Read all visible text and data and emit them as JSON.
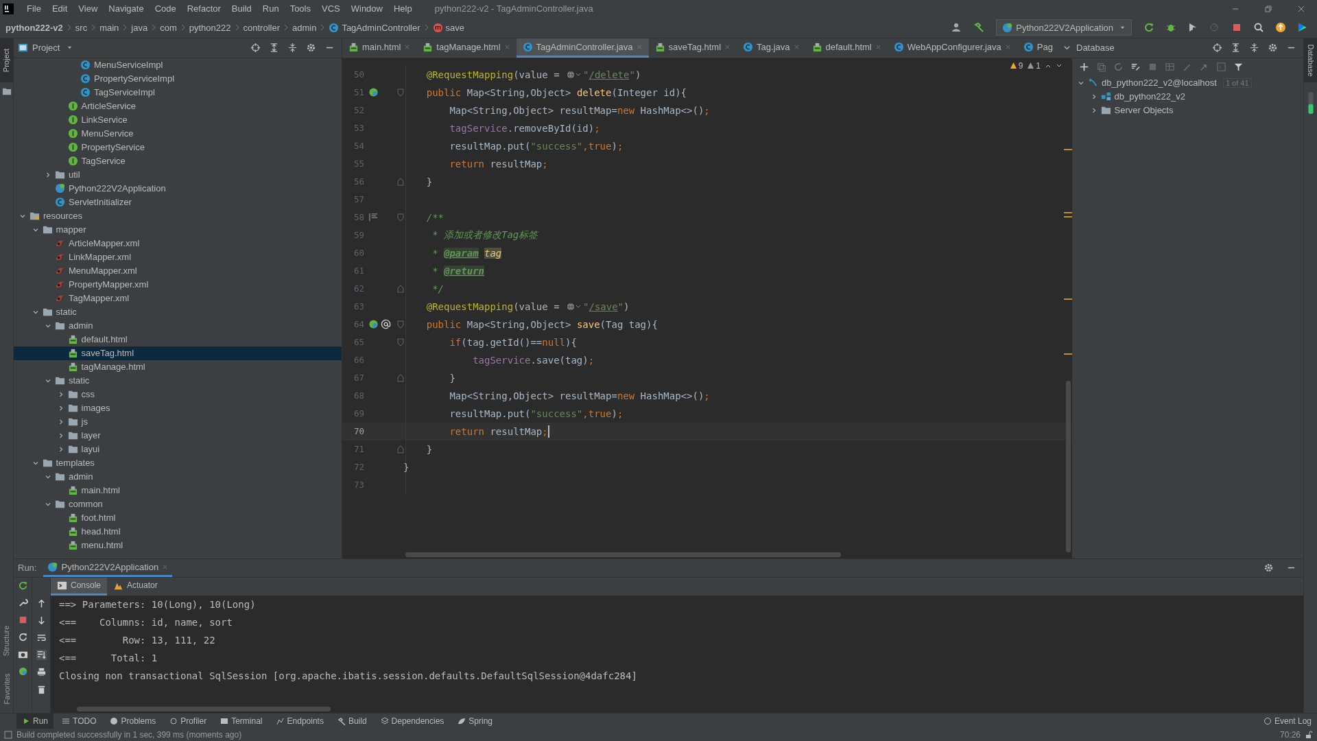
{
  "window": {
    "title": "python222-v2 - TagAdminController.java"
  },
  "menu": [
    "File",
    "Edit",
    "View",
    "Navigate",
    "Code",
    "Refactor",
    "Build",
    "Run",
    "Tools",
    "VCS",
    "Window",
    "Help"
  ],
  "breadcrumb": [
    {
      "label": "python222-v2",
      "kind": "project"
    },
    {
      "label": "src",
      "kind": "dir"
    },
    {
      "label": "main",
      "kind": "dir"
    },
    {
      "label": "java",
      "kind": "dir"
    },
    {
      "label": "com",
      "kind": "dir"
    },
    {
      "label": "python222",
      "kind": "dir"
    },
    {
      "label": "controller",
      "kind": "dir"
    },
    {
      "label": "admin",
      "kind": "dir"
    },
    {
      "label": "TagAdminController",
      "kind": "class"
    },
    {
      "label": "save",
      "kind": "method"
    }
  ],
  "run_config": {
    "label": "Python222V2Application"
  },
  "project_panel": {
    "title": "Project",
    "tree": [
      {
        "children": [
          {
            "children": [
              {
                "children": [
                  {
                    "children": [
                      {
                        "label": "MenuServiceImpl",
                        "kind": "class",
                        "selected": false
                      },
                      {
                        "label": "PropertyServiceImpl",
                        "kind": "class",
                        "selected": false
                      },
                      {
                        "label": "TagServiceImpl",
                        "kind": "class",
                        "selected": false
                      }
                    ]
                  },
                  {
                    "label": "ArticleService",
                    "kind": "interface",
                    "selected": false
                  },
                  {
                    "label": "LinkService",
                    "kind": "interface",
                    "selected": false
                  },
                  {
                    "label": "MenuService",
                    "kind": "interface",
                    "selected": false
                  },
                  {
                    "label": "PropertyService",
                    "kind": "interface",
                    "selected": false
                  },
                  {
                    "label": "TagService",
                    "kind": "interface",
                    "selected": false
                  }
                ]
              },
              {
                "label": "util",
                "kind": "folder",
                "expanded": false,
                "selected": false
              },
              {
                "label": "Python222V2Application",
                "kind": "app",
                "selected": false
              },
              {
                "label": "ServletInitializer",
                "kind": "class",
                "selected": false
              }
            ]
          }
        ]
      },
      {
        "label": "resources",
        "kind": "resources-folder",
        "expanded": true,
        "selected": false,
        "children": [
          {
            "label": "mapper",
            "kind": "folder",
            "expanded": true,
            "selected": false,
            "children": [
              {
                "label": "ArticleMapper.xml",
                "kind": "mybatis",
                "selected": false
              },
              {
                "label": "LinkMapper.xml",
                "kind": "mybatis",
                "selected": false
              },
              {
                "label": "MenuMapper.xml",
                "kind": "mybatis",
                "selected": false
              },
              {
                "label": "PropertyMapper.xml",
                "kind": "mybatis",
                "selected": false
              },
              {
                "label": "TagMapper.xml",
                "kind": "mybatis",
                "selected": false
              }
            ]
          },
          {
            "label": "static",
            "kind": "folder",
            "expanded": true,
            "selected": false,
            "children": [
              {
                "label": "admin",
                "kind": "folder",
                "expanded": true,
                "selected": false,
                "children": [
                  {
                    "label": "default.html",
                    "kind": "html",
                    "selected": false
                  },
                  {
                    "label": "saveTag.html",
                    "kind": "html",
                    "selected": true
                  },
                  {
                    "label": "tagManage.html",
                    "kind": "html",
                    "selected": false
                  }
                ]
              },
              {
                "label": "static",
                "kind": "folder",
                "expanded": true,
                "selected": false,
                "children": [
                  {
                    "label": "css",
                    "kind": "folder",
                    "expanded": false,
                    "selected": false
                  },
                  {
                    "label": "images",
                    "kind": "folder",
                    "expanded": false,
                    "selected": false
                  },
                  {
                    "label": "js",
                    "kind": "folder",
                    "expanded": false,
                    "selected": false
                  },
                  {
                    "label": "layer",
                    "kind": "folder",
                    "expanded": false,
                    "selected": false
                  },
                  {
                    "label": "layui",
                    "kind": "folder",
                    "expanded": false,
                    "selected": false
                  }
                ]
              }
            ]
          },
          {
            "label": "templates",
            "kind": "folder",
            "expanded": true,
            "selected": false,
            "children": [
              {
                "label": "admin",
                "kind": "folder",
                "expanded": true,
                "selected": false,
                "children": [
                  {
                    "label": "main.html",
                    "kind": "html",
                    "selected": false
                  }
                ]
              },
              {
                "label": "common",
                "kind": "folder",
                "expanded": true,
                "selected": false,
                "children": [
                  {
                    "label": "foot.html",
                    "kind": "html",
                    "selected": false
                  },
                  {
                    "label": "head.html",
                    "kind": "html",
                    "selected": false
                  },
                  {
                    "label": "menu.html",
                    "kind": "html",
                    "selected": false
                  }
                ]
              }
            ]
          }
        ]
      }
    ]
  },
  "editor": {
    "tabs": [
      {
        "label": "main.html",
        "kind": "html",
        "selected": false
      },
      {
        "label": "tagManage.html",
        "kind": "html",
        "selected": false
      },
      {
        "label": "TagAdminController.java",
        "kind": "class",
        "selected": true
      },
      {
        "label": "saveTag.html",
        "kind": "html",
        "selected": false
      },
      {
        "label": "Tag.java",
        "kind": "class",
        "selected": false
      },
      {
        "label": "default.html",
        "kind": "html",
        "selected": false
      },
      {
        "label": "WebAppConfigurer.java",
        "kind": "class",
        "selected": false
      },
      {
        "label": "Pag",
        "kind": "class",
        "selected": false
      }
    ],
    "problems": {
      "warnings": "9",
      "weak_warnings": "1"
    },
    "lines": [
      {
        "number": "50",
        "current": false,
        "tokens": [
          {
            "kind": "annotation",
            "text": "    @RequestMapping"
          },
          {
            "kind": "plain",
            "text": "(value = "
          },
          {
            "kind": "inlay"
          },
          {
            "kind": "string",
            "text": "\""
          },
          {
            "kind": "url",
            "text": "/delete"
          },
          {
            "kind": "string",
            "text": "\""
          },
          {
            "kind": "plain",
            "text": ")"
          }
        ]
      },
      {
        "number": "51",
        "current": false,
        "gutter": {
          "kind": "spring"
        },
        "fold": {
          "kind": "start"
        },
        "tokens": [
          {
            "kind": "keyword",
            "text": "    public"
          },
          {
            "kind": "plain",
            "text": " Map<String,Object> "
          },
          {
            "kind": "method",
            "text": "delete"
          },
          {
            "kind": "plain",
            "text": "(Integer id){"
          }
        ]
      },
      {
        "number": "52",
        "current": false,
        "tokens": [
          {
            "kind": "plain",
            "text": "        Map<String,Object> resultMap="
          },
          {
            "kind": "keyword",
            "text": "new"
          },
          {
            "kind": "plain",
            "text": " HashMap<>()"
          },
          {
            "kind": "keyword",
            "text": ";"
          }
        ]
      },
      {
        "number": "53",
        "current": false,
        "tokens": [
          {
            "kind": "field",
            "text": "        tagService"
          },
          {
            "kind": "plain",
            "text": ".removeById(id)"
          },
          {
            "kind": "keyword",
            "text": ";"
          }
        ]
      },
      {
        "number": "54",
        "current": false,
        "tokens": [
          {
            "kind": "plain",
            "text": "        resultMap.put("
          },
          {
            "kind": "string",
            "text": "\"success\""
          },
          {
            "kind": "keyword",
            "text": ",true"
          },
          {
            "kind": "plain",
            "text": ")"
          },
          {
            "kind": "keyword",
            "text": ";"
          }
        ]
      },
      {
        "number": "55",
        "current": false,
        "tokens": [
          {
            "kind": "keyword",
            "text": "        return"
          },
          {
            "kind": "plain",
            "text": " resultMap"
          },
          {
            "kind": "keyword",
            "text": ";"
          }
        ]
      },
      {
        "number": "56",
        "current": false,
        "fold": {
          "kind": "end"
        },
        "tokens": [
          {
            "kind": "plain",
            "text": "    }"
          }
        ]
      },
      {
        "number": "57",
        "current": false
      },
      {
        "number": "58",
        "current": false,
        "gutter": {
          "kind": "doc"
        },
        "fold": {
          "kind": "start"
        },
        "tokens": [
          {
            "kind": "comment",
            "text": "    /**"
          }
        ]
      },
      {
        "number": "59",
        "current": false,
        "tokens": [
          {
            "kind": "comment",
            "text": "     * 添加或者修改Tag标签"
          }
        ]
      },
      {
        "number": "60",
        "current": false,
        "tokens": [
          {
            "kind": "comment",
            "text": "     * "
          },
          {
            "kind": "doctag",
            "text": "@param"
          },
          {
            "kind": "docparam",
            "text": "tag"
          }
        ]
      },
      {
        "number": "61",
        "current": false,
        "tokens": [
          {
            "kind": "comment",
            "text": "     * "
          },
          {
            "kind": "doctag",
            "text": "@return"
          }
        ]
      },
      {
        "number": "62",
        "current": false,
        "fold": {
          "kind": "end"
        },
        "tokens": [
          {
            "kind": "comment",
            "text": "     */"
          }
        ]
      },
      {
        "number": "63",
        "current": false,
        "tokens": [
          {
            "kind": "annotation",
            "text": "    @RequestMapping"
          },
          {
            "kind": "plain",
            "text": "(value = "
          },
          {
            "kind": "inlay"
          },
          {
            "kind": "string",
            "text": "\""
          },
          {
            "kind": "url",
            "text": "/save"
          },
          {
            "kind": "string",
            "text": "\""
          },
          {
            "kind": "plain",
            "text": ")"
          }
        ]
      },
      {
        "number": "64",
        "current": false,
        "gutter": {
          "kind": "spring-at"
        },
        "fold": {
          "kind": "start"
        },
        "tokens": [
          {
            "kind": "keyword",
            "text": "    public"
          },
          {
            "kind": "plain",
            "text": " Map<String,Object> "
          },
          {
            "kind": "method",
            "text": "save"
          },
          {
            "kind": "plain",
            "text": "(Tag tag){"
          }
        ]
      },
      {
        "number": "65",
        "current": false,
        "fold": {
          "kind": "start"
        },
        "tokens": [
          {
            "kind": "keyword",
            "text": "        if"
          },
          {
            "kind": "plain",
            "text": "(tag.getId()=="
          },
          {
            "kind": "keyword",
            "text": "null"
          },
          {
            "kind": "plain",
            "text": "){"
          }
        ]
      },
      {
        "number": "66",
        "current": false,
        "tokens": [
          {
            "kind": "field",
            "text": "            tagService"
          },
          {
            "kind": "plain",
            "text": ".save(tag)"
          },
          {
            "kind": "keyword",
            "text": ";"
          }
        ]
      },
      {
        "number": "67",
        "current": false,
        "fold": {
          "kind": "end"
        },
        "tokens": [
          {
            "kind": "plain",
            "text": "        }"
          }
        ]
      },
      {
        "number": "68",
        "current": false,
        "tokens": [
          {
            "kind": "plain",
            "text": "        Map<String,Object> resultMap="
          },
          {
            "kind": "keyword",
            "text": "new"
          },
          {
            "kind": "plain",
            "text": " HashMap<>()"
          },
          {
            "kind": "keyword",
            "text": ";"
          }
        ]
      },
      {
        "number": "69",
        "current": false,
        "tokens": [
          {
            "kind": "plain",
            "text": "        resultMap.put("
          },
          {
            "kind": "string",
            "text": "\"success\""
          },
          {
            "kind": "keyword",
            "text": ",true"
          },
          {
            "kind": "plain",
            "text": ")"
          },
          {
            "kind": "keyword",
            "text": ";"
          }
        ]
      },
      {
        "number": "70",
        "current": true,
        "tokens": [
          {
            "kind": "keyword",
            "text": "        return"
          },
          {
            "kind": "plain",
            "text": " resultMap"
          },
          {
            "kind": "keyword",
            "text": ";"
          }
        ]
      },
      {
        "number": "71",
        "current": false,
        "fold": {
          "kind": "end"
        },
        "tokens": [
          {
            "kind": "plain",
            "text": "    }"
          }
        ]
      },
      {
        "number": "72",
        "current": false,
        "tokens": [
          {
            "kind": "plain",
            "text": "}"
          }
        ]
      },
      {
        "number": "73",
        "current": false
      }
    ]
  },
  "database_panel": {
    "title": "Database",
    "tree": [
      {
        "label": "db_python222_v2@localhost",
        "badge": "1 of 41",
        "kind": "datasource",
        "expanded": true,
        "selected": false,
        "children": [
          {
            "label": "db_python222_v2",
            "kind": "schema",
            "expanded": false,
            "selected": false
          },
          {
            "label": "Server Objects",
            "kind": "folder",
            "expanded": false,
            "selected": false
          }
        ]
      }
    ]
  },
  "run_panel": {
    "label": "Run:",
    "tabs": [
      {
        "label": "Python222V2Application",
        "selected": true
      }
    ],
    "subtabs": [
      {
        "label": "Console",
        "kind": "console",
        "selected": true
      },
      {
        "label": "Actuator",
        "kind": "actuator",
        "selected": false
      }
    ],
    "console": [
      "==> Parameters: 10(Long), 10(Long)",
      "<==    Columns: id, name, sort",
      "<==        Row: 13, 111, 22",
      "<==      Total: 1",
      "Closing non transactional SqlSession [org.apache.ibatis.session.defaults.DefaultSqlSession@4dafc284]"
    ]
  },
  "tool_tabs": [
    {
      "label": "Run",
      "kind": "run",
      "selected": true
    },
    {
      "label": "TODO",
      "kind": "todo",
      "selected": false
    },
    {
      "label": "Problems",
      "kind": "problems",
      "selected": false
    },
    {
      "label": "Profiler",
      "kind": "profiler",
      "selected": false
    },
    {
      "label": "Terminal",
      "kind": "terminal",
      "selected": false
    },
    {
      "label": "Endpoints",
      "kind": "endpoints",
      "selected": false
    },
    {
      "label": "Build",
      "kind": "build",
      "selected": false
    },
    {
      "label": "Dependencies",
      "kind": "dependencies",
      "selected": false
    },
    {
      "label": "Spring",
      "kind": "spring",
      "selected": false
    }
  ],
  "event_log": "Event Log",
  "side_stripes": {
    "left_top": [
      "Project"
    ],
    "left_bottom": [
      "Structure",
      "Favorites"
    ],
    "right": [
      "Database"
    ]
  },
  "status_bar": {
    "message": "Build completed successfully in 1 sec, 399 ms (moments ago)",
    "position": "70:26"
  }
}
